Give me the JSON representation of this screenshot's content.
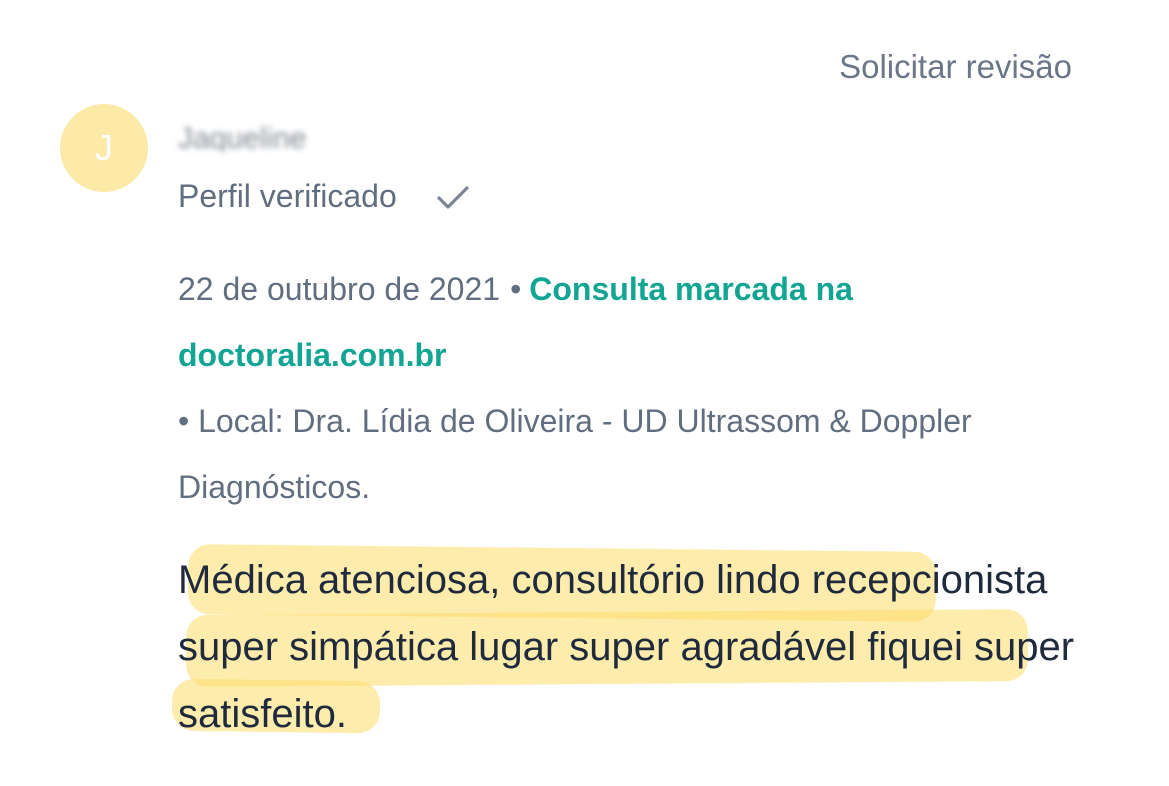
{
  "header": {
    "request_review_label": "Solicitar revisão"
  },
  "author": {
    "avatar_letter": "J",
    "name": "Jaqueline",
    "verified_label": "Perfil verificado",
    "verified_icon": "check-icon"
  },
  "meta": {
    "date": "22 de outubro de 2021",
    "separator": "•",
    "booked_link": "Consulta marcada na doctoralia.com.br",
    "location": "• Local: Dra. Lídia de Oliveira - UD Ultrassom & Doppler Diagnósticos."
  },
  "review": {
    "text": "Médica atenciosa, consultório lindo recepcionista super simpática lugar super agradável fiquei super satisfeito."
  },
  "colors": {
    "link": "#12a594",
    "muted_text": "#616e80",
    "body_text": "#1f2a3c",
    "avatar_bg": "#fde9a8",
    "highlighter": "#fddc69"
  }
}
